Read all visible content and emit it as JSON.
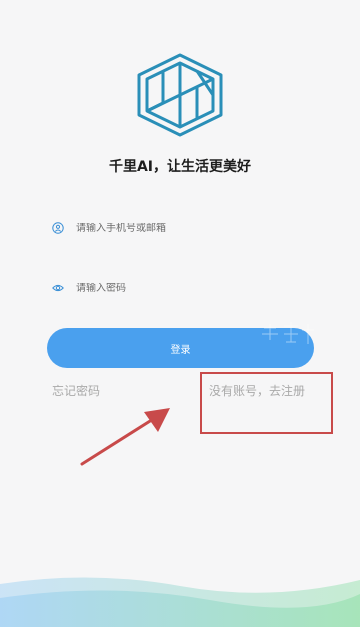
{
  "app": {
    "tagline": "千里AI，让生活更美好"
  },
  "login_form": {
    "phone_placeholder": "请输入手机号或邮箱",
    "password_placeholder": "请输入密码",
    "login_label": "登录",
    "forgot_password_label": "忘记密码",
    "register_label": "没有账号，去注册"
  },
  "icons": {
    "logo": "hexagon-cube-logo",
    "phone_field": "user-icon",
    "password_field": "eye-icon"
  },
  "colors": {
    "accent": "#4aa0ee",
    "logo": "#2a8fb8",
    "annotation": "#c84a4a",
    "wave_start": "#a8d4f5",
    "wave_end": "#9fe3b4"
  }
}
